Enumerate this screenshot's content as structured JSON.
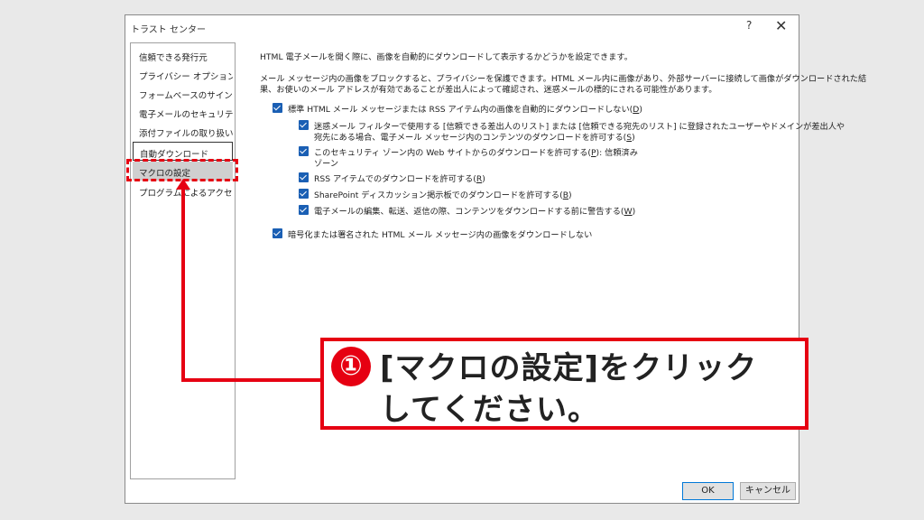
{
  "window": {
    "title": "トラスト センター",
    "help": "?",
    "close": "✕"
  },
  "sidebar": {
    "items": [
      {
        "label": "信頼できる発行元"
      },
      {
        "label": "プライバシー オプション"
      },
      {
        "label": "フォームベースのサインイン"
      },
      {
        "label": "電子メールのセキュリティ"
      },
      {
        "label": "添付ファイルの取り扱い"
      },
      {
        "label": "自動ダウンロード"
      },
      {
        "label": "マクロの設定"
      },
      {
        "label": "プログラムによるアクセス"
      }
    ]
  },
  "content": {
    "intro": "HTML 電子メールを開く際に、画像を自動的にダウンロードして表示するかどうかを設定できます。",
    "desc_line1": "メール メッセージ内の画像をブロックすると、プライバシーを保護できます。HTML メール内に画像があり、外部サーバーに接続して画像がダウンロードされた結",
    "desc_line2": "果、お使いのメール アドレスが有効であることが差出人によって確認され、迷惑メールの標的にされる可能性があります。",
    "opt_main": {
      "text": "標準 HTML メール メッセージまたは RSS アイテム内の画像を自動的にダウンロードしない(",
      "key": "D",
      "end": ")"
    },
    "opt_junk": {
      "line1": "迷惑メール フィルターで使用する [信頼できる差出人のリスト] または [信頼できる宛先のリスト] に登録されたユーザーやドメインが差出人や",
      "line2": "宛先にある場合、電子メール メッセージ内のコンテンツのダウンロードを許可する(",
      "key": "S",
      "end": ")"
    },
    "opt_zone": {
      "line1": "このセキュリティ ゾーン内の Web サイトからのダウンロードを許可する(",
      "key": "P",
      "line1_end": "): 信頼済み",
      "line2": "ゾーン"
    },
    "opt_rss": {
      "text": "RSS アイテムでのダウンロードを許可する(",
      "key": "R",
      "end": ")"
    },
    "opt_sharepoint": {
      "text": "SharePoint ディスカッション掲示板でのダウンロードを許可する(",
      "key": "B",
      "end": ")"
    },
    "opt_warn": {
      "text": "電子メールの編集、転送、返信の際、コンテンツをダウンロードする前に警告する(",
      "key": "W",
      "end": ")"
    },
    "opt_encrypted": {
      "text": "暗号化または署名された HTML メール メッセージ内の画像をダウンロードしない"
    }
  },
  "footer": {
    "ok_label": "OK",
    "cancel_label": "キャンセル"
  },
  "callout": {
    "step": "①",
    "line1": "[マクロの設定]をクリック",
    "line2": "してください。"
  },
  "colors": {
    "accent_red": "#e60012",
    "checkbox_blue": "#1a5fb4"
  }
}
